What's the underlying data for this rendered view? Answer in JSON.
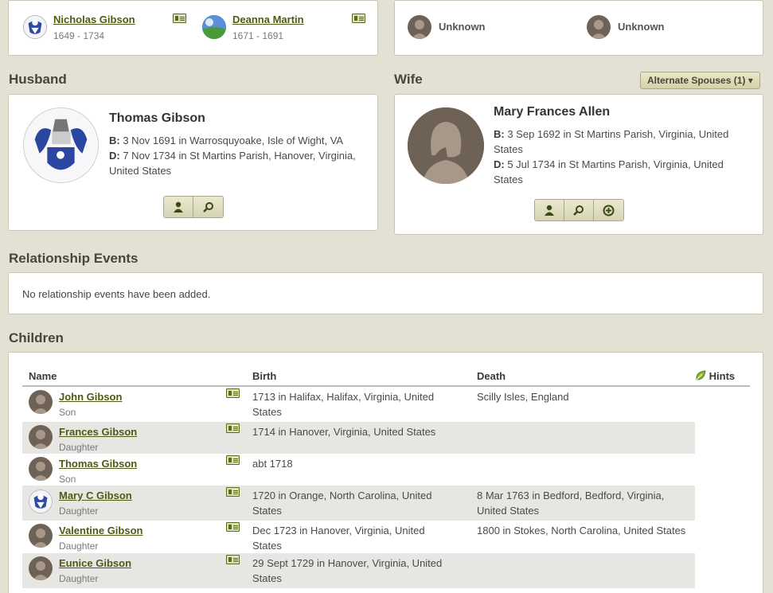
{
  "parents_husband": [
    {
      "name": "Nicholas Gibson",
      "dates": "1649 - 1734",
      "avatar": "coat-of-arms"
    },
    {
      "name": "Deanna Martin",
      "dates": "1671 - 1691",
      "avatar": "landscape"
    }
  ],
  "parents_wife": [
    {
      "name": "Unknown"
    },
    {
      "name": "Unknown"
    }
  ],
  "husband": {
    "section_label": "Husband",
    "name": "Thomas Gibson",
    "birth_label": "B:",
    "birth": "3 Nov 1691 in Warrosquyoake, Isle of Wight, VA",
    "death_label": "D:",
    "death": "7 Nov 1734 in St Martins Parish, Hanover, Virginia, United States"
  },
  "wife": {
    "section_label": "Wife",
    "alternate_spouses": "Alternate Spouses (1) ▾",
    "name": "Mary Frances Allen",
    "birth_label": "B:",
    "birth": "3 Sep 1692 in St Martins Parish, Virginia, United States",
    "death_label": "D:",
    "death": "5 Jul 1734 in St Martins Parish, Virginia, United States"
  },
  "relationship_events": {
    "title": "Relationship Events",
    "empty_text": "No relationship events have been added."
  },
  "children": {
    "title": "Children",
    "columns": {
      "name": "Name",
      "birth": "Birth",
      "death": "Death",
      "hints": "Hints"
    },
    "rows": [
      {
        "name": "John Gibson",
        "relation": "Son",
        "birth": "1713 in Halifax, Halifax, Virginia, United States",
        "death": "Scilly Isles, England",
        "avatar": "silhouette"
      },
      {
        "name": "Frances Gibson",
        "relation": "Daughter",
        "birth": "1714 in Hanover, Virginia, United States",
        "death": "",
        "avatar": "silhouette"
      },
      {
        "name": "Thomas Gibson",
        "relation": "Son",
        "birth": "abt 1718",
        "death": "",
        "avatar": "silhouette"
      },
      {
        "name": "Mary C Gibson",
        "relation": "Daughter",
        "birth": "1720 in Orange, North Carolina, United States",
        "death": "8 Mar 1763 in Bedford, Bedford, Virginia, United States",
        "avatar": "coat-of-arms"
      },
      {
        "name": "Valentine Gibson",
        "relation": "Daughter",
        "birth": "Dec 1723 in Hanover, Virginia, United States",
        "death": "1800 in Stokes, North Carolina, United States",
        "avatar": "silhouette"
      },
      {
        "name": "Eunice Gibson",
        "relation": "Daughter",
        "birth": "29 Sept 1729 in Hanover, Virginia, United States",
        "death": "",
        "avatar": "silhouette"
      }
    ]
  },
  "colors": {
    "link": "#4d5b14",
    "background": "#e3e0d4",
    "avatar": "#6e6257",
    "row_shade": "#e8e6e3"
  }
}
